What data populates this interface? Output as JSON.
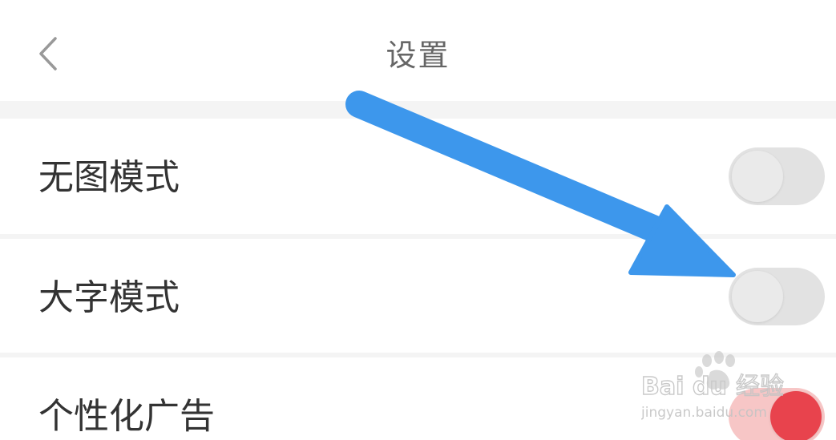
{
  "header": {
    "title": "设置",
    "back_icon": "chevron-left-icon"
  },
  "settings": [
    {
      "label": "无图模式",
      "enabled": false
    },
    {
      "label": "大字模式",
      "enabled": false
    },
    {
      "label": "个性化广告",
      "enabled": true
    }
  ],
  "annotation": {
    "type": "arrow",
    "color": "#3d97ec",
    "points_to": "大字模式"
  },
  "watermark": {
    "brand": "Bai du 经验",
    "url": "jingyan.baidu.com"
  },
  "colors": {
    "toggle_off": "#e2e2e2",
    "toggle_on": "#e8434d",
    "separator": "#f4f4f4",
    "text_primary": "#333333",
    "text_title": "#666666"
  }
}
